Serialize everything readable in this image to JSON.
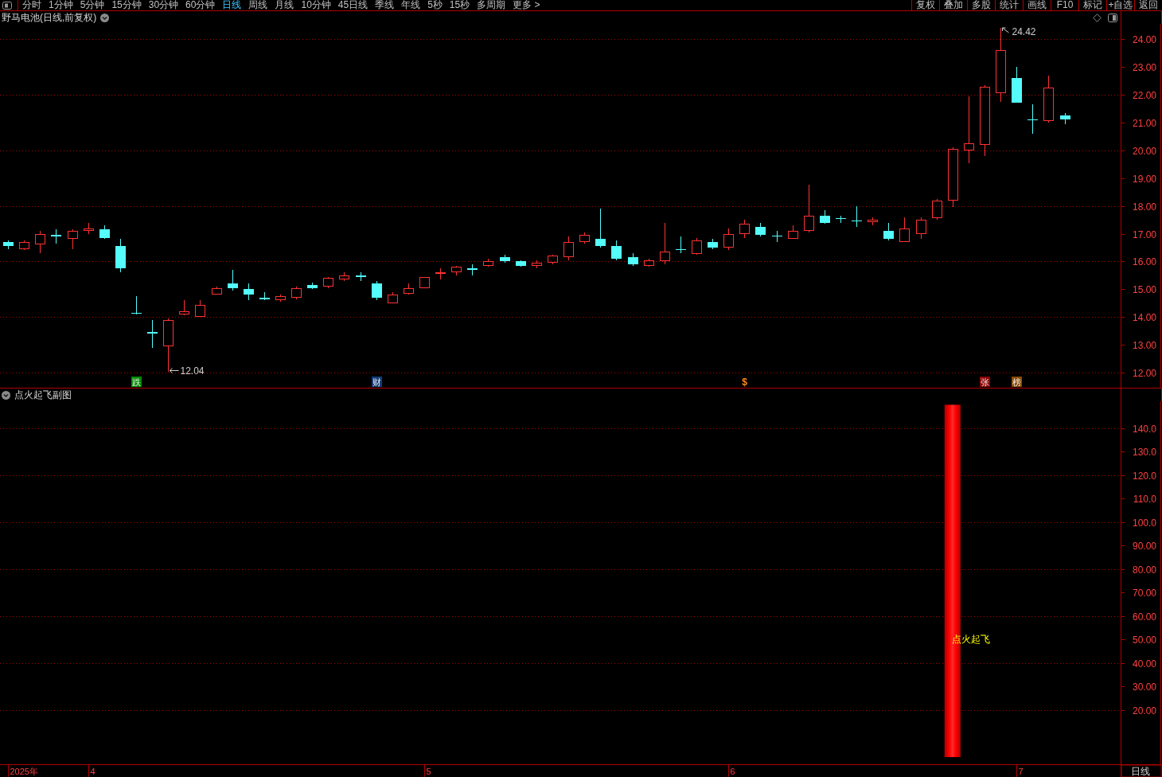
{
  "toolbar": {
    "periods": [
      {
        "label": "分时",
        "selected": false
      },
      {
        "label": "1分钟",
        "selected": false
      },
      {
        "label": "5分钟",
        "selected": false
      },
      {
        "label": "15分钟",
        "selected": false
      },
      {
        "label": "30分钟",
        "selected": false
      },
      {
        "label": "60分钟",
        "selected": false
      },
      {
        "label": "日线",
        "selected": true
      },
      {
        "label": "周线",
        "selected": false
      },
      {
        "label": "月线",
        "selected": false
      },
      {
        "label": "10分钟",
        "selected": false
      },
      {
        "label": "45日线",
        "selected": false
      },
      {
        "label": "季线",
        "selected": false
      },
      {
        "label": "年线",
        "selected": false
      },
      {
        "label": "5秒",
        "selected": false
      },
      {
        "label": "15秒",
        "selected": false
      },
      {
        "label": "多周期",
        "selected": false
      },
      {
        "label": "更多 >",
        "selected": false
      }
    ],
    "buttons": [
      "复权",
      "叠加",
      "多股",
      "统计",
      "画线",
      "F10",
      "标记",
      "+自选",
      "返回"
    ]
  },
  "main_chart": {
    "title": "野马电池(日线,前复权)",
    "price_axis": [
      "24.00",
      "23.00",
      "22.00",
      "21.00",
      "20.00",
      "19.00",
      "18.00",
      "17.00",
      "16.00",
      "15.00",
      "14.00",
      "13.00",
      "12.00"
    ],
    "high_label": "24.42",
    "low_label": "12.04",
    "event_markers": [
      {
        "kind": "badge",
        "text": "跌",
        "color": "#008a00"
      },
      {
        "kind": "badge",
        "text": "财",
        "color": "#143c78"
      },
      {
        "kind": "glyph",
        "text": "$",
        "color": "#ff8c1a"
      },
      {
        "kind": "badge",
        "text": "张",
        "color": "#8c0000"
      },
      {
        "kind": "badge",
        "text": "榜",
        "color": "#8a4a00"
      }
    ]
  },
  "sub_chart": {
    "title": "点火起飞副图",
    "chart_data": {
      "type": "bar",
      "categories": [
        "2025年",
        null,
        null,
        null,
        null,
        "4",
        null,
        null,
        null,
        null,
        null,
        null,
        null,
        null,
        null,
        null,
        null,
        null,
        null,
        null,
        null,
        null,
        null,
        null,
        null,
        null,
        "5",
        null,
        null,
        null,
        null,
        null,
        null,
        null,
        null,
        null,
        null,
        null,
        null,
        null,
        null,
        null,
        null,
        null,
        null,
        "6",
        null,
        null,
        null,
        null,
        null,
        null,
        null,
        null,
        null,
        null,
        null,
        null,
        null,
        null,
        null,
        null,
        null,
        "7",
        null,
        null,
        null,
        null,
        null,
        null
      ],
      "values": [
        0,
        0,
        0,
        0,
        0,
        0,
        0,
        0,
        0,
        0,
        0,
        0,
        0,
        0,
        0,
        0,
        0,
        0,
        0,
        0,
        0,
        0,
        0,
        0,
        0,
        0,
        0,
        0,
        0,
        0,
        0,
        0,
        0,
        0,
        0,
        0,
        0,
        0,
        0,
        0,
        0,
        0,
        0,
        0,
        0,
        0,
        0,
        0,
        0,
        0,
        0,
        0,
        0,
        0,
        0,
        0,
        0,
        0,
        0,
        150,
        0,
        0,
        0,
        0,
        0,
        0,
        0,
        null,
        null,
        null
      ],
      "ylim": [
        -3.05,
        151.5
      ],
      "yticks": [
        {
          "value": 140,
          "label": "140.0"
        },
        {
          "value": 130,
          "label": "130.0"
        },
        {
          "value": 120,
          "label": "120.0"
        },
        {
          "value": 110,
          "label": "110.0"
        },
        {
          "value": 100,
          "label": "100.0"
        },
        {
          "value": 90,
          "label": "90.00"
        },
        {
          "value": 80,
          "label": "80.00"
        },
        {
          "value": 70,
          "label": "70.00"
        },
        {
          "value": 60,
          "label": "60.00"
        },
        {
          "value": 50,
          "label": "50.00"
        },
        {
          "value": 40,
          "label": "40.00"
        },
        {
          "value": 30,
          "label": "30.00"
        },
        {
          "value": 20,
          "label": "20.00"
        }
      ],
      "grid": true,
      "annotations": [
        "点火起飞"
      ]
    }
  },
  "period_label": "日线"
}
